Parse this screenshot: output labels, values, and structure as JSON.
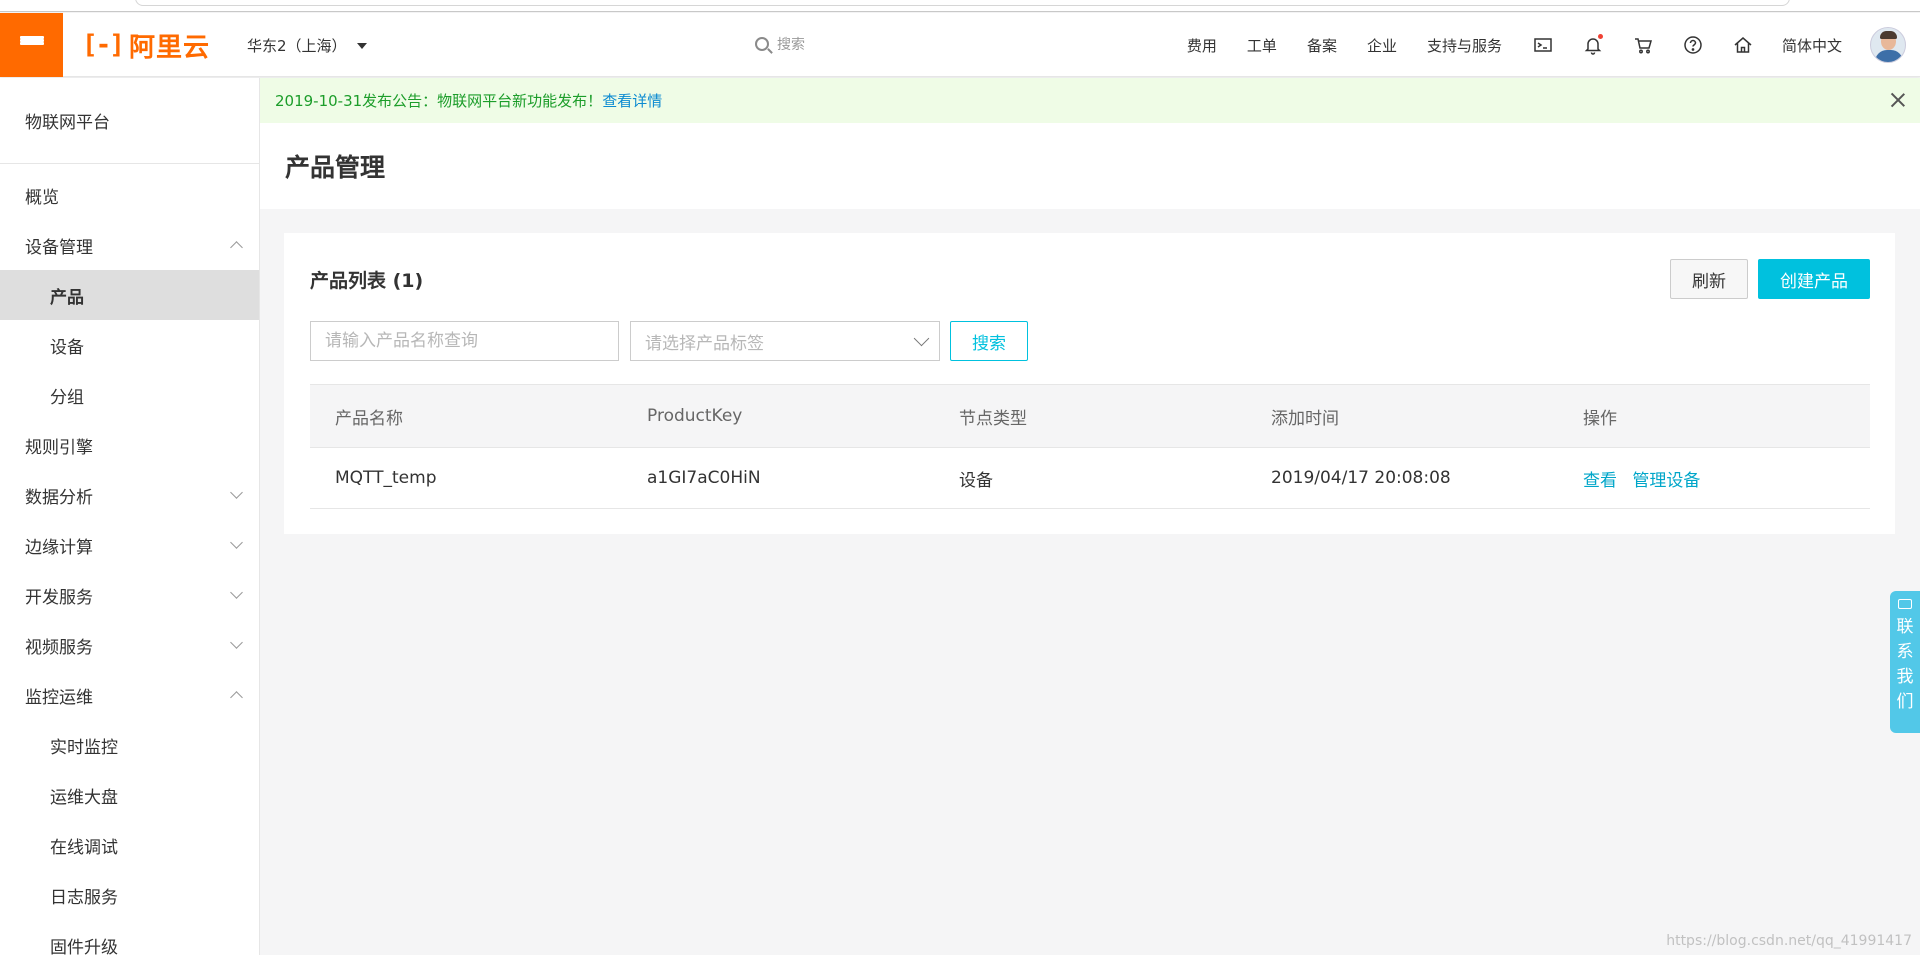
{
  "topbar": {
    "logo_text": "阿里云",
    "logo_mark": "[-]",
    "region": "华东2（上海）",
    "search_placeholder": "搜索",
    "nav_links": [
      "费用",
      "工单",
      "备案",
      "企业",
      "支持与服务"
    ],
    "language": "简体中文",
    "icons": [
      "terminal-icon",
      "bell-icon",
      "cart-icon",
      "help-icon",
      "home-icon"
    ]
  },
  "sidebar": {
    "title": "物联网平台",
    "items": [
      {
        "label": "概览",
        "level": 0
      },
      {
        "label": "设备管理",
        "level": 0,
        "chevron": "up"
      },
      {
        "label": "产品",
        "level": 1,
        "active": true
      },
      {
        "label": "设备",
        "level": 1
      },
      {
        "label": "分组",
        "level": 1
      },
      {
        "label": "规则引擎",
        "level": 0
      },
      {
        "label": "数据分析",
        "level": 0,
        "chevron": "down"
      },
      {
        "label": "边缘计算",
        "level": 0,
        "chevron": "down"
      },
      {
        "label": "开发服务",
        "level": 0,
        "chevron": "down"
      },
      {
        "label": "视频服务",
        "level": 0,
        "chevron": "down"
      },
      {
        "label": "监控运维",
        "level": 0,
        "chevron": "up"
      },
      {
        "label": "实时监控",
        "level": 1
      },
      {
        "label": "运维大盘",
        "level": 1
      },
      {
        "label": "在线调试",
        "level": 1
      },
      {
        "label": "日志服务",
        "level": 1
      },
      {
        "label": "固件升级",
        "level": 1
      }
    ]
  },
  "notice": {
    "text": "2019-10-31发布公告：物联网平台新功能发布！",
    "link": "查看详情"
  },
  "page": {
    "title": "产品管理"
  },
  "product_list": {
    "title": "产品列表 (1)",
    "refresh_label": "刷新",
    "create_label": "创建产品",
    "name_placeholder": "请输入产品名称查询",
    "tag_placeholder": "请选择产品标签",
    "search_label": "搜索",
    "columns": [
      "产品名称",
      "ProductKey",
      "节点类型",
      "添加时间",
      "操作"
    ],
    "rows": [
      {
        "name": "MQTT_temp",
        "product_key": "a1GI7aC0HiN",
        "node_type": "设备",
        "created": "2019/04/17 20:08:08",
        "actions": [
          "查看",
          "管理设备"
        ]
      }
    ]
  },
  "contact": {
    "chars": [
      "联",
      "系",
      "我",
      "们"
    ]
  },
  "watermark": "https://blog.csdn.net/qq_41991417",
  "colors": {
    "brand": "#ff6a00",
    "accent": "#00c1de",
    "notice_bg": "#effce6",
    "notice_text": "#1c9d2a"
  }
}
